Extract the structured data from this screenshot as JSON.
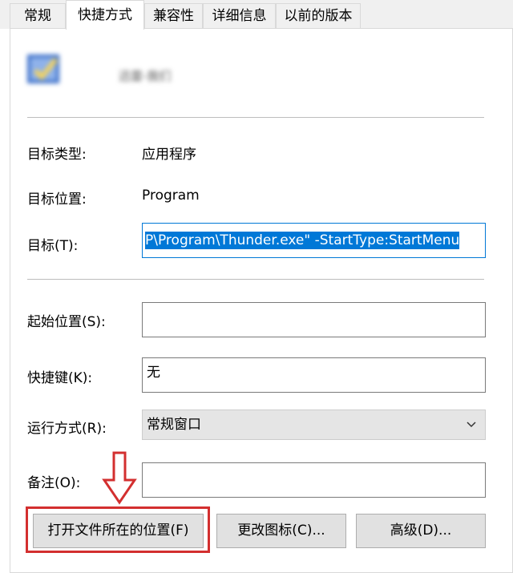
{
  "tabs": [
    {
      "label": "常规"
    },
    {
      "label": "快捷方式"
    },
    {
      "label": "兼容性"
    },
    {
      "label": "详细信息"
    },
    {
      "label": "以前的版本"
    }
  ],
  "app": {
    "name": "迅雷-我们",
    "icon": "blurred-app-icon"
  },
  "fields": {
    "target_type_label": "目标类型:",
    "target_type_value": "应用程序",
    "target_location_label": "目标位置:",
    "target_location_value": "Program",
    "target_label": "目标(T):",
    "target_value": "P\\Program\\Thunder.exe\" -StartType:StartMenu",
    "start_in_label": "起始位置(S):",
    "start_in_value": "",
    "shortcut_key_label": "快捷键(K):",
    "shortcut_key_value": "无",
    "run_label": "运行方式(R):",
    "run_value": "常规窗口",
    "comment_label": "备注(O):",
    "comment_value": ""
  },
  "buttons": {
    "open_location": "打开文件所在的位置(F)",
    "change_icon": "更改图标(C)...",
    "advanced": "高级(D)..."
  },
  "colors": {
    "highlight": "#0078d7",
    "annotation": "#d32f2f"
  }
}
